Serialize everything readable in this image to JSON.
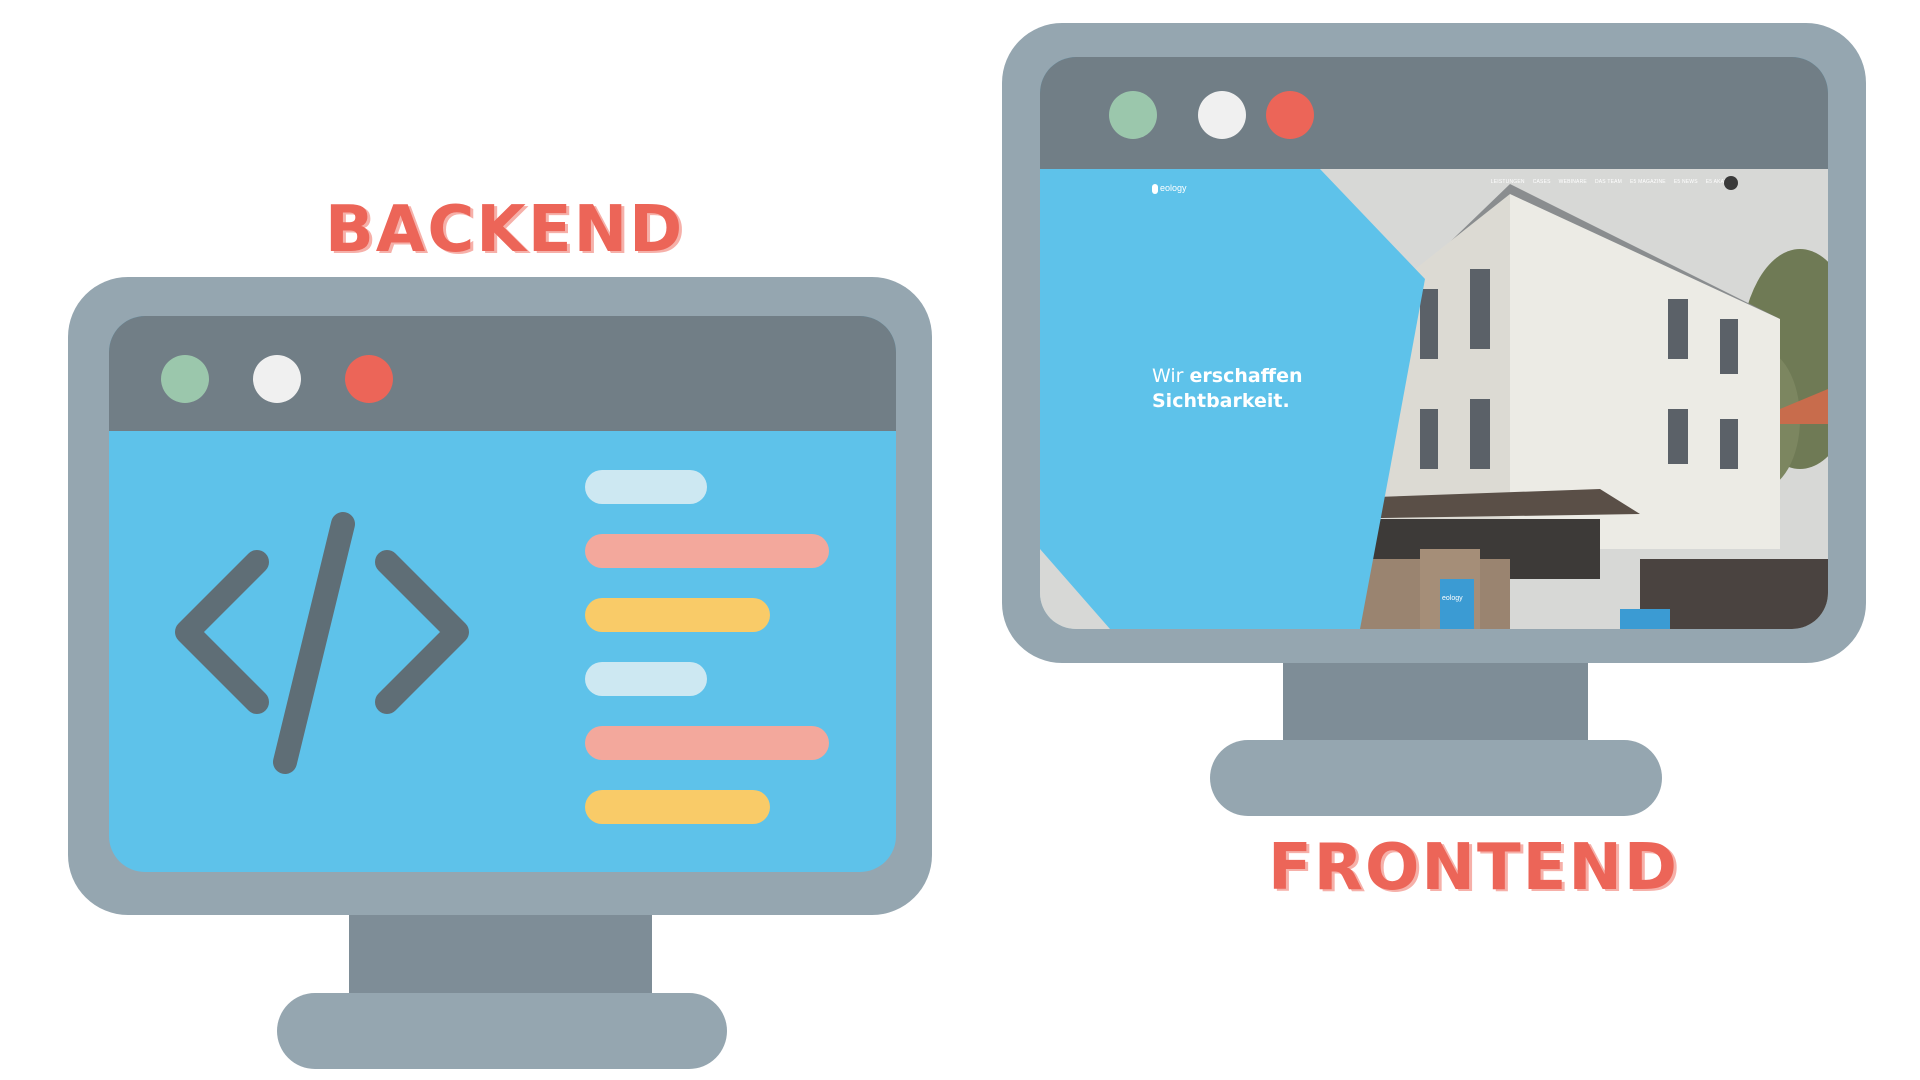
{
  "backend": {
    "heading": "BACKEND",
    "code_icon": "code-brackets-icon",
    "colors": {
      "bezel": "#95a6b0",
      "titlebar": "#717e86",
      "screen": "#5ec2ea",
      "dot_green": "#9bc7ac",
      "dot_white": "#f0f0f0",
      "dot_red": "#ec6558",
      "line_blue": "#cde8f2",
      "line_pink": "#f3a89c",
      "line_yellow": "#f9cb68"
    }
  },
  "frontend": {
    "heading": "FRONTEND",
    "website": {
      "logo_text": "eology",
      "nav": [
        "LEISTUNGEN",
        "CASES",
        "WEBINARE",
        "DAS TEAM",
        "E5 MAGAZINE",
        "E5 NEWS",
        "E5 AKAD"
      ],
      "hero_line1_prefix": "Wir ",
      "hero_line1_bold": "erschaffen",
      "hero_line2_bold": "Sichtbarkeit.",
      "sign_text": "eology",
      "menu_icon": "hamburger-menu-icon"
    }
  },
  "heading_color": "#ec6558"
}
